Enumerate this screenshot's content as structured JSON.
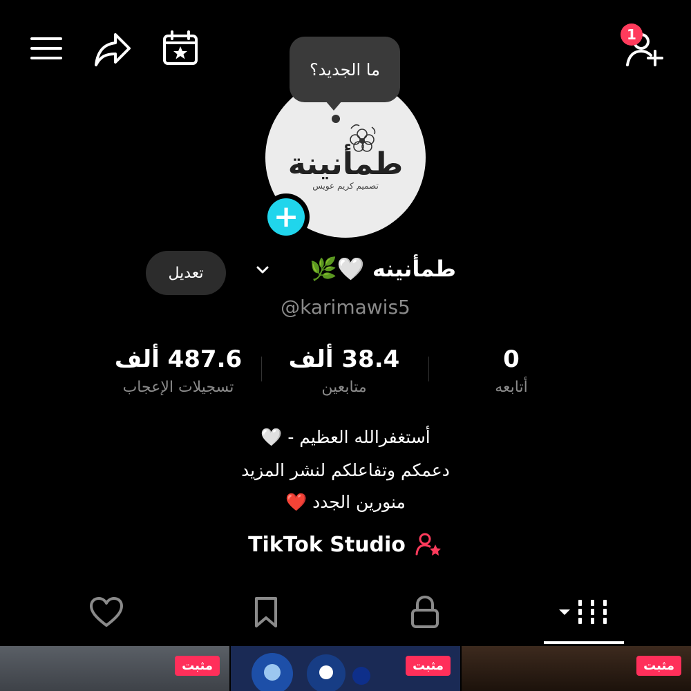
{
  "header": {
    "menu_icon": "menu-icon",
    "share_icon": "share-icon",
    "calendar_icon": "calendar-star-icon",
    "add_friend_icon": "add-friend-icon",
    "notification_count": "1"
  },
  "tooltip": {
    "text": "ما الجديد؟"
  },
  "avatar": {
    "logo_text": "طمأنينة",
    "logo_subtext": "تصميم كريم عويس"
  },
  "profile": {
    "display_name": "طمأنينه 🤍🌿",
    "username": "@karimawis5",
    "edit_label": "تعديل"
  },
  "stats": {
    "likes": {
      "value": "487.6 ألف",
      "label": "تسجيلات الإعجاب"
    },
    "followers": {
      "value": "38.4 ألف",
      "label": "متابعين"
    },
    "following": {
      "value": "0",
      "label": "أتابعه"
    }
  },
  "bio": {
    "line1": "أستغفرالله العظيم - 🤍",
    "line2": "دعمكم وتفاعلكم لنشر المزيد",
    "line3": "منورين الجدد ❤️"
  },
  "studio": {
    "label": "TikTok Studio"
  },
  "tabs": {
    "liked_icon": "heart-icon",
    "saved_icon": "bookmark-icon",
    "private_icon": "lock-icon",
    "videos_icon": "grid-icon"
  },
  "thumbnails": [
    {
      "badge": "مثبت"
    },
    {
      "badge": "مثبت"
    },
    {
      "badge": "مثبت"
    }
  ],
  "colors": {
    "background": "#000000",
    "accent_pink": "#ff2f5a",
    "accent_cyan": "#20d5ec",
    "muted_text": "#8a8a8a"
  }
}
